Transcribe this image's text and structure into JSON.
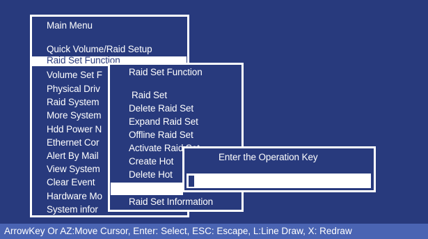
{
  "main_menu": {
    "title": "Main Menu",
    "items": [
      "Quick Volume/Raid Setup",
      "Raid Set Function",
      "Volume Set Function",
      "Physical Drives",
      "Raid System Function",
      "More System Functions",
      "Hdd Power Management",
      "Ethernet Configuration",
      "Alert By Mail Config",
      "View System Events",
      "Clear Event Buffer",
      "Hardware Monitor",
      "System information"
    ],
    "visible_items": [
      "Volume Set F",
      "Physical Driv",
      "Raid System",
      "More System",
      "Hdd Power N",
      "Ethernet Cor",
      "Alert By Mail",
      "View System",
      "Clear Event",
      "Hardware Mo",
      "System infor"
    ],
    "selected_index": 1
  },
  "raid_submenu": {
    "title": "Raid Set Function",
    "items": [
      "Raid Set",
      "Delete Raid Set",
      "Expand Raid Set",
      "Offline Raid Set",
      "Activate Raid Set",
      "Create Hot Spare",
      "Delete Hot Spare",
      "",
      "Raid Set Information"
    ],
    "visible_items": [
      "Raid Set",
      "Delete Raid Set",
      "Expand Raid Set",
      "Offline Raid Set",
      "Activate Raid Set",
      "Create Hot",
      "Delete Hot"
    ],
    "last_item": "Raid Set Information",
    "selected_index": 7
  },
  "operation_key_dialog": {
    "title": "Enter the Operation Key",
    "value": ""
  },
  "status_bar": {
    "text": "ArrowKey Or AZ:Move Cursor, Enter: Select, ESC: Escape, L:Line Draw, X: Redraw"
  },
  "colors": {
    "background": "#283a7d",
    "status_bar": "#4a64b3",
    "foreground": "#ffffff"
  }
}
